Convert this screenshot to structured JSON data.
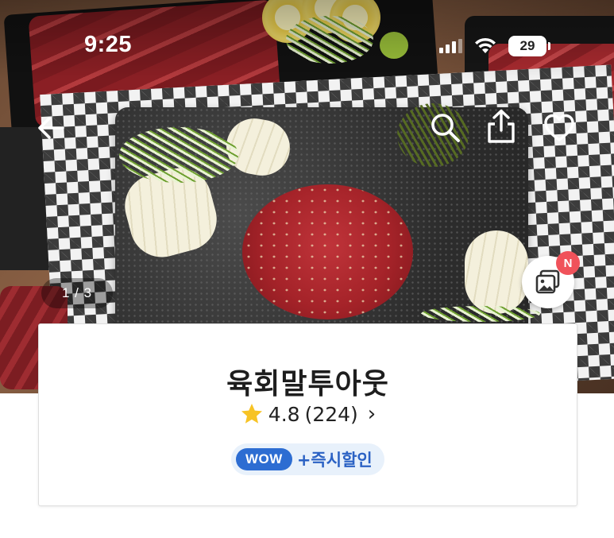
{
  "status_bar": {
    "time": "9:25",
    "battery_level": "29"
  },
  "nav": {
    "back_icon": "arrow-left-icon",
    "search_icon": "search-icon",
    "share_icon": "share-icon",
    "like_icon": "heart-icon"
  },
  "gallery": {
    "page_indicator": "1 / 3",
    "photo_icon": "photo-gallery-icon",
    "new_badge": "N"
  },
  "store": {
    "name": "육회말투아웃",
    "rating": "4.8",
    "review_count": "(224)",
    "star_icon": "star-icon",
    "chevron": "›",
    "wow_badge": "WOW",
    "discount_label": "+즉시할인"
  },
  "colors": {
    "accent_blue": "#2d6dd2",
    "discount_text": "#2b62c4",
    "badge_red": "#f0525a",
    "star_yellow": "#f7c325"
  }
}
